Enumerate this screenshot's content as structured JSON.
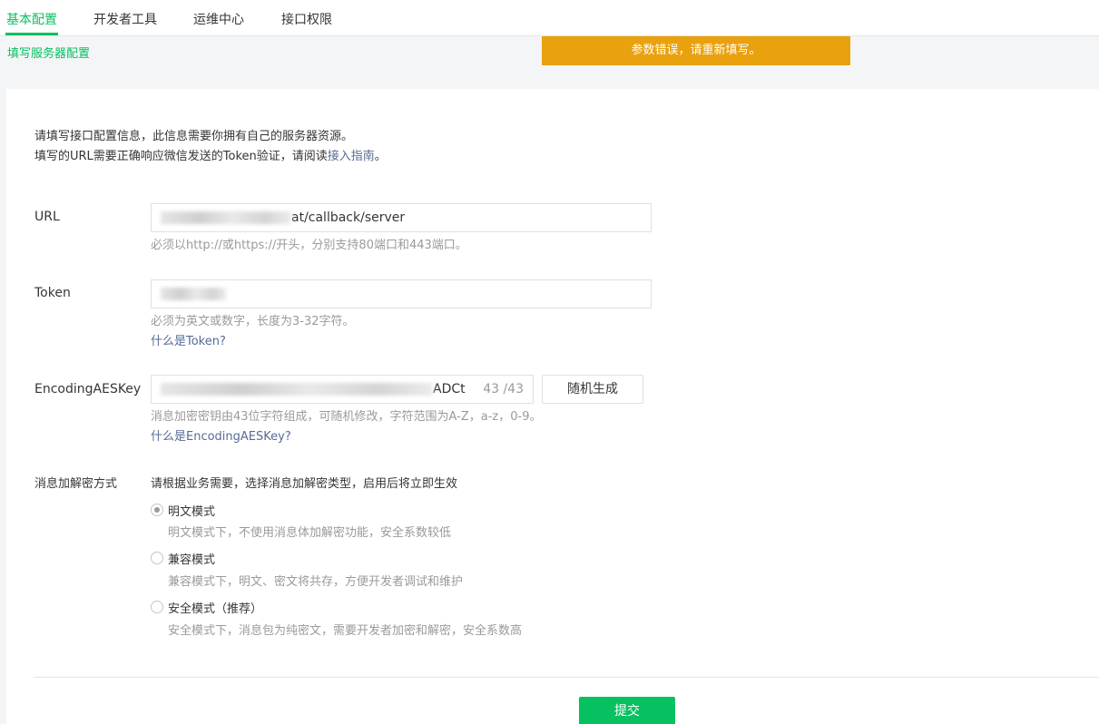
{
  "tabs": [
    {
      "label": "基本配置",
      "active": true
    },
    {
      "label": "开发者工具",
      "active": false
    },
    {
      "label": "运维中心",
      "active": false
    },
    {
      "label": "接口权限",
      "active": false
    }
  ],
  "subtitle": "填写服务器配置",
  "toast": "参数错误，请重新填写。",
  "intro": {
    "line1": "请填写接口配置信息，此信息需要你拥有自己的服务器资源。",
    "line2_prefix": "填写的URL需要正确响应微信发送的Token验证，请阅读",
    "line2_link": "接入指南",
    "line2_suffix": "。"
  },
  "url": {
    "label": "URL",
    "value_visible": "at/callback/server",
    "hint": "必须以http://或https://开头，分别支持80端口和443端口。"
  },
  "token": {
    "label": "Token",
    "hint": "必须为英文或数字，长度为3-32字符。",
    "help_link": "什么是Token?"
  },
  "aes": {
    "label": "EncodingAESKey",
    "value_visible": "ADCt",
    "counter": "43 /43",
    "generate_button": "随机生成",
    "hint": "消息加密密钥由43位字符组成，可随机修改，字符范围为A-Z，a-z，0-9。",
    "help_link": "什么是EncodingAESKey?"
  },
  "encryption": {
    "label": "消息加解密方式",
    "description": "请根据业务需要，选择消息加解密类型，启用后将立即生效",
    "options": [
      {
        "label": "明文模式",
        "desc": "明文模式下，不使用消息体加解密功能，安全系数较低",
        "checked": true
      },
      {
        "label": "兼容模式",
        "desc": "兼容模式下，明文、密文将共存，方便开发者调试和维护",
        "checked": false
      },
      {
        "label": "安全模式（推荐）",
        "desc": "安全模式下，消息包为纯密文，需要开发者加密和解密，安全系数高",
        "checked": false
      }
    ]
  },
  "submit_label": "提交",
  "colors": {
    "accent": "#07c160",
    "warning": "#e9a10e",
    "link": "#576b95"
  }
}
